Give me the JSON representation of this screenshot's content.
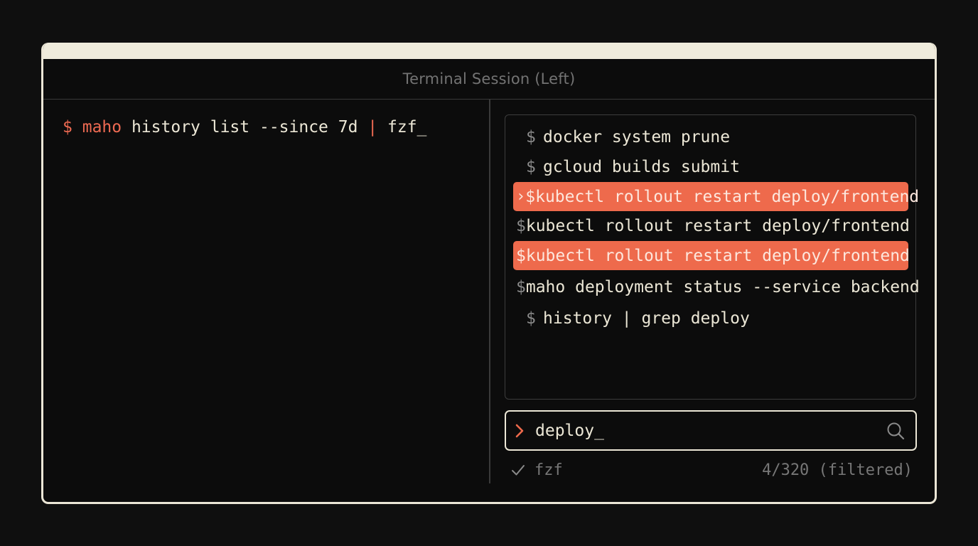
{
  "window": {
    "title": "Terminal Session (Left)"
  },
  "left_pane": {
    "prompt_symbol": "$",
    "command_name": "maho",
    "command_args": " history list --since 7d ",
    "pipe": "|",
    "pipe_target": " fzf_"
  },
  "fzf": {
    "results": [
      {
        "prompt": "$",
        "command": "docker system prune",
        "selected": false,
        "pointer": ""
      },
      {
        "prompt": "$",
        "command": "gcloud builds submit",
        "selected": false,
        "pointer": ""
      },
      {
        "prompt": "$",
        "command": "kubectl rollout restart deploy/frontend",
        "selected": true,
        "pointer": "›"
      },
      {
        "prompt": "$",
        "command": "kubectl rollout restart deploy/frontend",
        "selected": false,
        "pointer": ""
      },
      {
        "prompt": "$",
        "command": "kubectl rollout restart deploy/frontend",
        "selected": true,
        "pointer": ""
      },
      {
        "prompt": "$",
        "command": "maho deployment status --service backend",
        "selected": false,
        "pointer": ""
      },
      {
        "prompt": "$",
        "command": "history | grep deploy",
        "selected": false,
        "pointer": ""
      }
    ],
    "query": "deploy_",
    "status_label": "fzf",
    "match_count": "4/320 (filtered)",
    "icons": {
      "prompt": "chevron-right-icon",
      "search": "search-icon",
      "status": "check-icon"
    }
  },
  "colors": {
    "accent": "#ee6a4c",
    "background": "#0c0c0c",
    "frame": "#ebe6d6",
    "text": "#ece7d6",
    "muted": "#777777"
  }
}
